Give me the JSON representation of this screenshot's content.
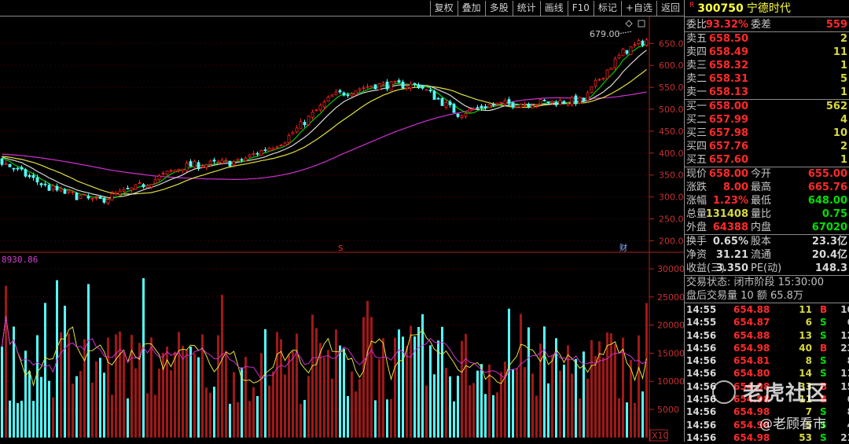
{
  "toolbar": {
    "buttons": [
      "复权",
      "叠加",
      "多股",
      "统计",
      "画线",
      "F10",
      "标记",
      "+自选",
      "返回"
    ]
  },
  "kline": {
    "price_axis": [
      "650.0",
      "600.0",
      "550.0",
      "500.0",
      "450.0",
      "400.0",
      "350.0",
      "300.0",
      "250.0",
      "200.0"
    ],
    "volume_axis": [
      "30000",
      "25000",
      "20000",
      "15000",
      "10000",
      "5000"
    ],
    "volume_unit": "X10",
    "volume_indicator_value": "8930.86",
    "high_marker": "679.00",
    "event_markers": [
      "S",
      "财"
    ],
    "price_path": [
      [
        0,
        380
      ],
      [
        12,
        320
      ],
      [
        24,
        290
      ],
      [
        34,
        320
      ],
      [
        46,
        370
      ],
      [
        60,
        380
      ],
      [
        72,
        430
      ],
      [
        84,
        530
      ],
      [
        94,
        555
      ],
      [
        106,
        555
      ],
      [
        116,
        490
      ],
      [
        124,
        510
      ],
      [
        136,
        515
      ],
      [
        148,
        520
      ],
      [
        152,
        570
      ],
      [
        158,
        630
      ],
      [
        164,
        658
      ]
    ],
    "ma_colors": {
      "ma5": "#00c800",
      "ma10": "#d8d8d8",
      "ma20": "#e0e040",
      "ma60": "#d030d0"
    },
    "up_color": "#ff2020",
    "down_color": "#54fcfc"
  },
  "quote": {
    "r_badge": "R",
    "code": "300750",
    "name": "宁德时代",
    "wei_bi_label": "委比",
    "wei_bi": "93.32%",
    "wei_cha_label": "委差",
    "wei_cha": "559",
    "asks": [
      {
        "label": "卖五",
        "price": "658.50",
        "vol": "2"
      },
      {
        "label": "卖四",
        "price": "658.49",
        "vol": "11"
      },
      {
        "label": "卖三",
        "price": "658.32",
        "vol": "1"
      },
      {
        "label": "卖二",
        "price": "658.31",
        "vol": "5"
      },
      {
        "label": "卖一",
        "price": "658.13",
        "vol": "1"
      }
    ],
    "bids": [
      {
        "label": "买一",
        "price": "658.00",
        "vol": "562"
      },
      {
        "label": "买二",
        "price": "657.99",
        "vol": "4"
      },
      {
        "label": "买三",
        "price": "657.98",
        "vol": "10"
      },
      {
        "label": "买四",
        "price": "657.76",
        "vol": "2"
      },
      {
        "label": "买五",
        "price": "657.60",
        "vol": "1"
      }
    ],
    "stats": [
      {
        "l1": "现价",
        "v1": "658.00",
        "c1": "red",
        "l2": "今开",
        "v2": "655.00",
        "c2": "red"
      },
      {
        "l1": "涨跌",
        "v1": "8.00",
        "c1": "red",
        "l2": "最高",
        "v2": "665.76",
        "c2": "red"
      },
      {
        "l1": "涨幅",
        "v1": "1.23%",
        "c1": "red",
        "l2": "最低",
        "v2": "648.00",
        "c2": "grn"
      },
      {
        "l1": "总量",
        "v1": "131408",
        "c1": "yel",
        "l2": "量比",
        "v2": "0.75",
        "c2": "grn"
      },
      {
        "l1": "外盘",
        "v1": "64388",
        "c1": "red",
        "l2": "内盘",
        "v2": "67020",
        "c2": "grn"
      }
    ],
    "fundamentals": [
      {
        "l1": "换手",
        "v1": "0.65%",
        "l2": "股本",
        "v2": "23.3亿"
      },
      {
        "l1": "净资",
        "v1": "31.21",
        "l2": "流通",
        "v2": "20.4亿"
      },
      {
        "l1": "收益(三)",
        "v1": "3.350",
        "l2": "PE(动)",
        "v2": "148.3"
      }
    ],
    "status": "交易状态: 闭市阶段 15:30:00",
    "after_hours": "盘后交易量 10 额 65.8万"
  },
  "ticks": [
    {
      "time": "14:55",
      "price": "654.88",
      "vol": "11",
      "side": "B",
      "n": "10"
    },
    {
      "time": "14:55",
      "price": "654.87",
      "vol": "6",
      "side": "S",
      "n": "6"
    },
    {
      "time": "14:56",
      "price": "654.88",
      "vol": "13",
      "side": "S",
      "n": "12"
    },
    {
      "time": "14:56",
      "price": "654.98",
      "vol": "40",
      "side": "B",
      "n": "23"
    },
    {
      "time": "14:56",
      "price": "654.81",
      "vol": "8",
      "side": "S",
      "n": "8"
    },
    {
      "time": "14:56",
      "price": "654.80",
      "vol": "14",
      "side": "S",
      "n": "11"
    },
    {
      "time": "14:56",
      "price": "654.98",
      "vol": "33",
      "side": "B",
      "n": "15"
    },
    {
      "time": "14:56",
      "price": "654.98",
      "vol": "11",
      "side": "B",
      "n": "6"
    },
    {
      "time": "14:56",
      "price": "654.98",
      "vol": "7",
      "side": "S",
      "n": "8"
    },
    {
      "time": "14:56",
      "price": "654.98",
      "vol": "5",
      "side": "S",
      "n": "4"
    },
    {
      "time": "14:56",
      "price": "654.98",
      "vol": "53",
      "side": "S",
      "n": "21"
    }
  ],
  "watermark": {
    "brand": "老虎社区",
    "author": "@老顾看市"
  }
}
